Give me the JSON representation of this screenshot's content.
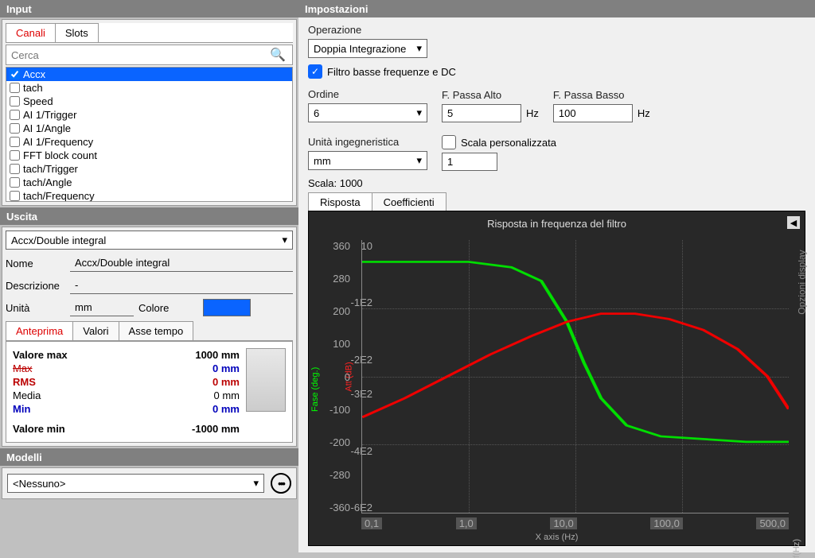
{
  "headers": {
    "input": "Input",
    "impostazioni": "Impostazioni",
    "uscita": "Uscita",
    "modelli": "Modelli"
  },
  "input": {
    "tabs": {
      "canali": "Canali",
      "slots": "Slots"
    },
    "search_placeholder": "Cerca",
    "channels": [
      "Accx",
      "tach",
      "Speed",
      "AI 1/Trigger",
      "AI 1/Angle",
      "AI 1/Frequency",
      "FFT block count",
      "tach/Trigger",
      "tach/Angle",
      "tach/Frequency"
    ]
  },
  "uscita": {
    "select_value": "Accx/Double integral",
    "nome_label": "Nome",
    "nome_value": "Accx/Double integral",
    "descr_label": "Descrizione",
    "descr_value": "-",
    "unita_label": "Unità",
    "unita_value": "mm",
    "colore_label": "Colore",
    "subtabs": {
      "anteprima": "Anteprima",
      "valori": "Valori",
      "asse_tempo": "Asse tempo"
    },
    "stats": {
      "valmax_label": "Valore max",
      "valmax": "1000 mm",
      "max_label": "Max",
      "max_val": "0 mm",
      "rms_label": "RMS",
      "rms_val": "0 mm",
      "media_label": "Media",
      "media_val": "0 mm",
      "min_label": "Min",
      "min_val": "0 mm",
      "valmin_label": "Valore min",
      "valmin": "-1000 mm"
    }
  },
  "modelli": {
    "value": "<Nessuno>"
  },
  "settings": {
    "operazione_label": "Operazione",
    "operazione_value": "Doppia Integrazione",
    "filtro_check_label": "Filtro basse frequenze e DC",
    "ordine_label": "Ordine",
    "ordine_value": "6",
    "fpa_label": "F. Passa Alto",
    "fpa_value": "5",
    "hz": "Hz",
    "fpb_label": "F. Passa Basso",
    "fpb_value": "100",
    "unita_ing_label": "Unità ingegneristica",
    "unita_ing_value": "mm",
    "scala_pers_label": "Scala personalizzata",
    "scala_pers_value": "1",
    "scala_label": "Scala: 1000",
    "resp_tabs": {
      "risposta": "Risposta",
      "coeff": "Coefficienti"
    }
  },
  "chart": {
    "title": "Risposta in frequenza del filtro",
    "y1_label": "Fase (deg.)",
    "y2_label": "Att (dB)",
    "x_label": "X axis (Hz)",
    "f_label": "f(Hz)",
    "side_label": "Opzioni display",
    "y1_ticks": [
      "360",
      "280",
      "200",
      "100",
      "0",
      "-100",
      "-200",
      "-280",
      "-360"
    ],
    "y2_ticks": [
      "10",
      "",
      "-1E2",
      "",
      "-2E2",
      "-3E2",
      "",
      "-4E2",
      "",
      "-6E2"
    ],
    "x_ticks": [
      "0,1",
      "1,0",
      "10,0",
      "100,0",
      "500,0"
    ]
  },
  "chart_data": {
    "type": "line",
    "x_scale": "log",
    "x_range": [
      0.1,
      500
    ],
    "series": [
      {
        "name": "Fase (deg.)",
        "color": "#00dd00",
        "axis": "left",
        "x": [
          0.1,
          1,
          2,
          3,
          5,
          7,
          10,
          20,
          50,
          100,
          200,
          500
        ],
        "y": [
          310,
          310,
          308,
          300,
          250,
          150,
          20,
          -110,
          -160,
          -175,
          -178,
          -180
        ]
      },
      {
        "name": "Att (dB)",
        "color": "#ee0000",
        "axis": "right",
        "x": [
          0.1,
          0.3,
          1,
          3,
          5,
          10,
          30,
          100,
          300,
          500
        ],
        "y": [
          -260,
          -180,
          -120,
          -60,
          -35,
          -20,
          -25,
          -55,
          -100,
          -160
        ]
      }
    ]
  }
}
